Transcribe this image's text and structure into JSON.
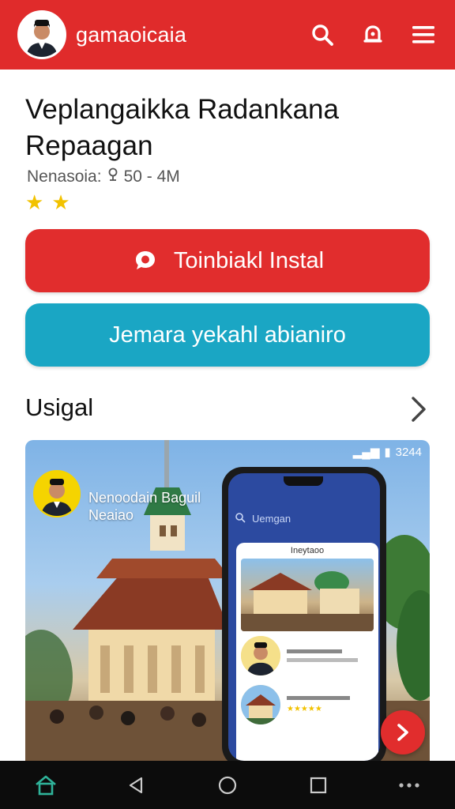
{
  "header": {
    "app_title": "gamaoicaia",
    "icons": [
      "search-icon",
      "notification-icon",
      "menu-icon"
    ]
  },
  "app": {
    "title_line1": "Veplangaikka Radankana",
    "title_line2": "Repaagan",
    "meta_label": "Nenasoia:",
    "meta_value": "50 - 4M",
    "rating_stars": 2
  },
  "actions": {
    "primary_label": "Toinbiakl Instal",
    "secondary_label": "Jemara yekahl abianiro"
  },
  "section": {
    "title": "Usigal"
  },
  "banner": {
    "status_time": "3244",
    "promo_line1": "Nenoodain Baguil",
    "promo_line2": "Neaiao",
    "phone_search": "Uemgan",
    "card_header": "Ineytaoo"
  },
  "colors": {
    "brand_red": "#e02b2b",
    "accent_teal": "#1aa6c4",
    "star_yellow": "#f2c200"
  }
}
